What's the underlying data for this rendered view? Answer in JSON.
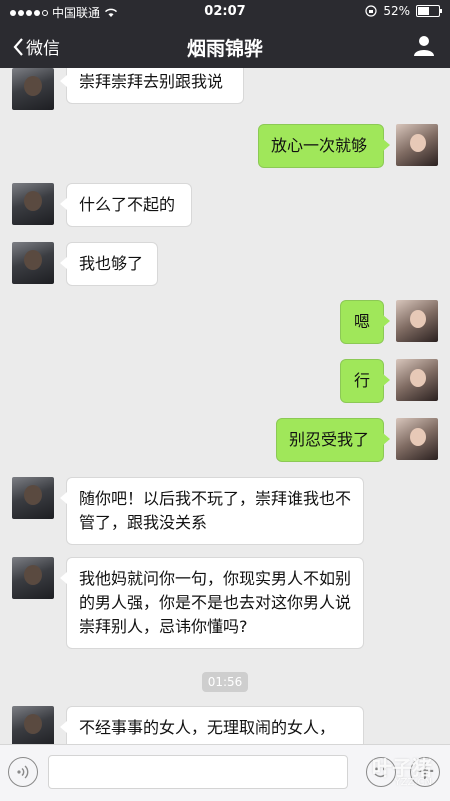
{
  "status_bar": {
    "carrier": "中国联通",
    "time": "02:07",
    "battery": "52%",
    "battery_level": 0.52
  },
  "nav": {
    "back_label": "微信",
    "title": "烟雨锦骅"
  },
  "messages": [
    {
      "side": "left",
      "text": "崇拜崇拜去别跟我说"
    },
    {
      "side": "right",
      "text": "放心一次就够"
    },
    {
      "side": "left",
      "text": "什么了不起的"
    },
    {
      "side": "left",
      "text": "我也够了"
    },
    {
      "side": "right",
      "text": "嗯"
    },
    {
      "side": "right",
      "text": "行"
    },
    {
      "side": "right",
      "text": "别忍受我了"
    },
    {
      "side": "left",
      "text": "随你吧！以后我不玩了，崇拜谁我也不管了，跟我没关系"
    },
    {
      "side": "left",
      "text": "我他妈就问你一句，你现实男人不如别的男人强，你是不是也去对这你男人说崇拜别人，忌讳你懂吗?"
    },
    {
      "side": "left",
      "text": "不经事事的女人，无理取闹的女人，"
    }
  ],
  "timestamp": "01:56",
  "watermark": {
    "text": "叶子猪",
    "url": "YZZ.CN"
  }
}
